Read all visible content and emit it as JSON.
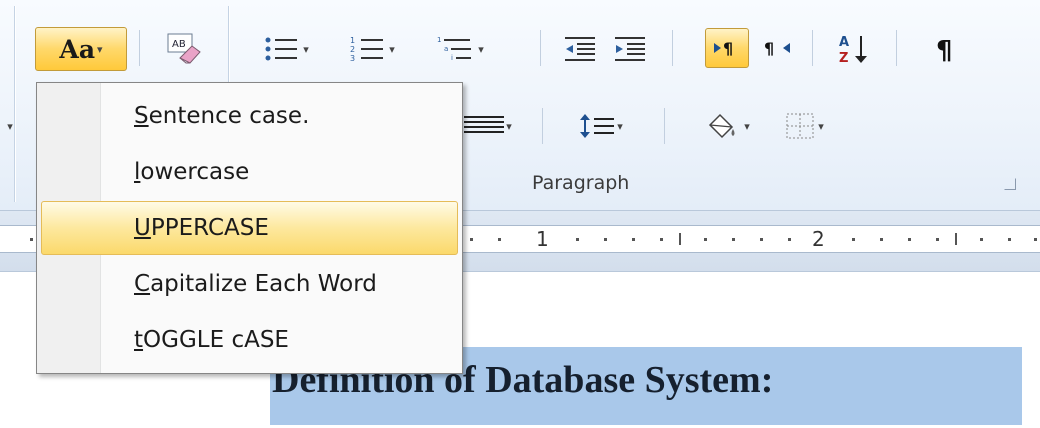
{
  "ribbon": {
    "change_case_button": {
      "label": "Aa",
      "icon": "chevron-down-icon"
    },
    "buttons": [
      {
        "name": "clear-formatting",
        "icon": "eraser-icon"
      },
      {
        "name": "bullets",
        "icon": "bullet-list-icon"
      },
      {
        "name": "numbering",
        "icon": "numbered-list-icon"
      },
      {
        "name": "multilevel-list",
        "icon": "multilevel-list-icon"
      },
      {
        "name": "decrease-indent",
        "icon": "decrease-indent-icon"
      },
      {
        "name": "increase-indent",
        "icon": "increase-indent-icon"
      },
      {
        "name": "left-to-right",
        "icon": "ltr-paragraph-icon"
      },
      {
        "name": "right-to-left",
        "icon": "rtl-paragraph-icon"
      },
      {
        "name": "sort",
        "icon": "sort-az-icon"
      },
      {
        "name": "show-hide",
        "icon": "pilcrow-icon"
      },
      {
        "name": "justify",
        "icon": "justify-icon"
      },
      {
        "name": "line-spacing",
        "icon": "line-spacing-icon"
      },
      {
        "name": "shading",
        "icon": "paint-bucket-icon"
      },
      {
        "name": "borders",
        "icon": "border-icon"
      }
    ],
    "paragraph_group_label": "Paragraph",
    "colors": {
      "active_fill": "#ffd86a",
      "active_border": "#c29b3a"
    }
  },
  "ruler": {
    "numbers": [
      "1",
      "2"
    ]
  },
  "change_case_menu": {
    "items": [
      {
        "accel": "S",
        "rest": "entence case.",
        "highlighted": false
      },
      {
        "accel": "l",
        "rest": "owercase",
        "highlighted": false
      },
      {
        "accel": "U",
        "rest": "PPERCASE",
        "highlighted": true
      },
      {
        "accel": "C",
        "rest": "apitalize Each Word",
        "highlighted": false
      },
      {
        "accel": "t",
        "rest": "OGGLE cASE",
        "highlighted": false
      }
    ]
  },
  "document": {
    "heading": "Definition of Database System:",
    "heading_highlight_color": "#a9c8ea"
  }
}
